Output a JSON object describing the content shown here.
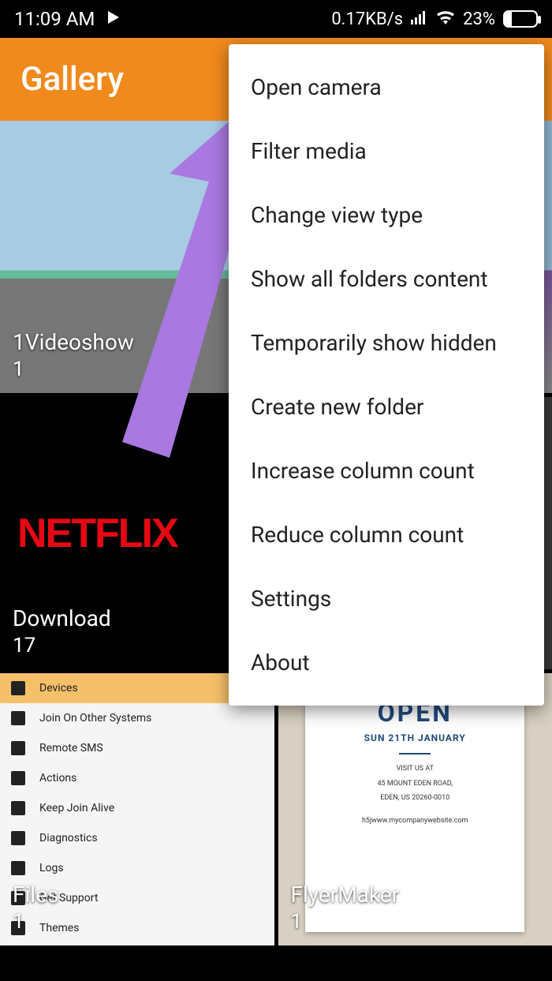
{
  "status": {
    "time": "11:09 AM",
    "net_speed": "0.17KB/s",
    "battery_pct": "23%"
  },
  "app": {
    "title": "Gallery"
  },
  "tiles": [
    {
      "name": "1Videoshow",
      "count": "1"
    },
    {
      "name": "",
      "count": ""
    },
    {
      "name": "Download",
      "count": "17",
      "logo": "NETFLIX"
    },
    {
      "name": "",
      "count": ""
    },
    {
      "name": "Files",
      "count": "1",
      "list": [
        "Devices",
        "Join On Other Systems",
        "Remote SMS",
        "Actions",
        "Keep Join Alive",
        "Diagnostics",
        "Logs",
        "Get Support",
        "Themes"
      ]
    },
    {
      "name": "FlyerMaker",
      "count": "1",
      "flyer": {
        "headline": "OPEN",
        "date": "SUN 21TH JANUARY",
        "visit": "VISIT US AT",
        "addr1": "45 MOUNT EDEN ROAD,",
        "addr2": "EDEN, US 20260-0010",
        "site": "h5jwww.mycompanywebsite.com"
      }
    }
  ],
  "menu": {
    "items": [
      "Open camera",
      "Filter media",
      "Change view type",
      "Show all folders content",
      "Temporarily show hidden",
      "Create new folder",
      "Increase column count",
      "Reduce column count",
      "Settings",
      "About"
    ]
  }
}
